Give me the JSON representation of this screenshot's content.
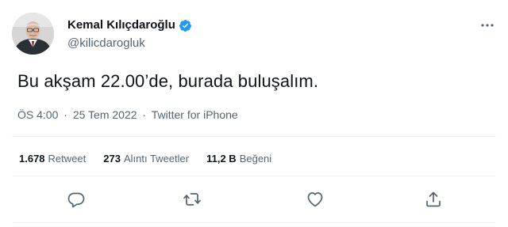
{
  "author": {
    "display_name": "Kemal Kılıçdaroğlu",
    "handle": "@kilicdarogluk",
    "verified": true
  },
  "tweet": {
    "text": "Bu akşam 22.00’de, burada buluşalım.",
    "time": "ÖS 4:00",
    "date": "25 Tem 2022",
    "separator": "·",
    "source": "Twitter for iPhone"
  },
  "stats": [
    {
      "count": "1.678",
      "label": "Retweet"
    },
    {
      "count": "273",
      "label": "Alıntı Tweetler"
    },
    {
      "count": "11,2 B",
      "label": "Beğeni"
    }
  ],
  "actions": [
    "reply-icon",
    "retweet-icon",
    "like-icon",
    "share-icon"
  ],
  "colors": {
    "text_primary": "#0f1419",
    "text_secondary": "#536471",
    "verified_blue": "#1d9bf0",
    "divider": "#eff3f4"
  }
}
